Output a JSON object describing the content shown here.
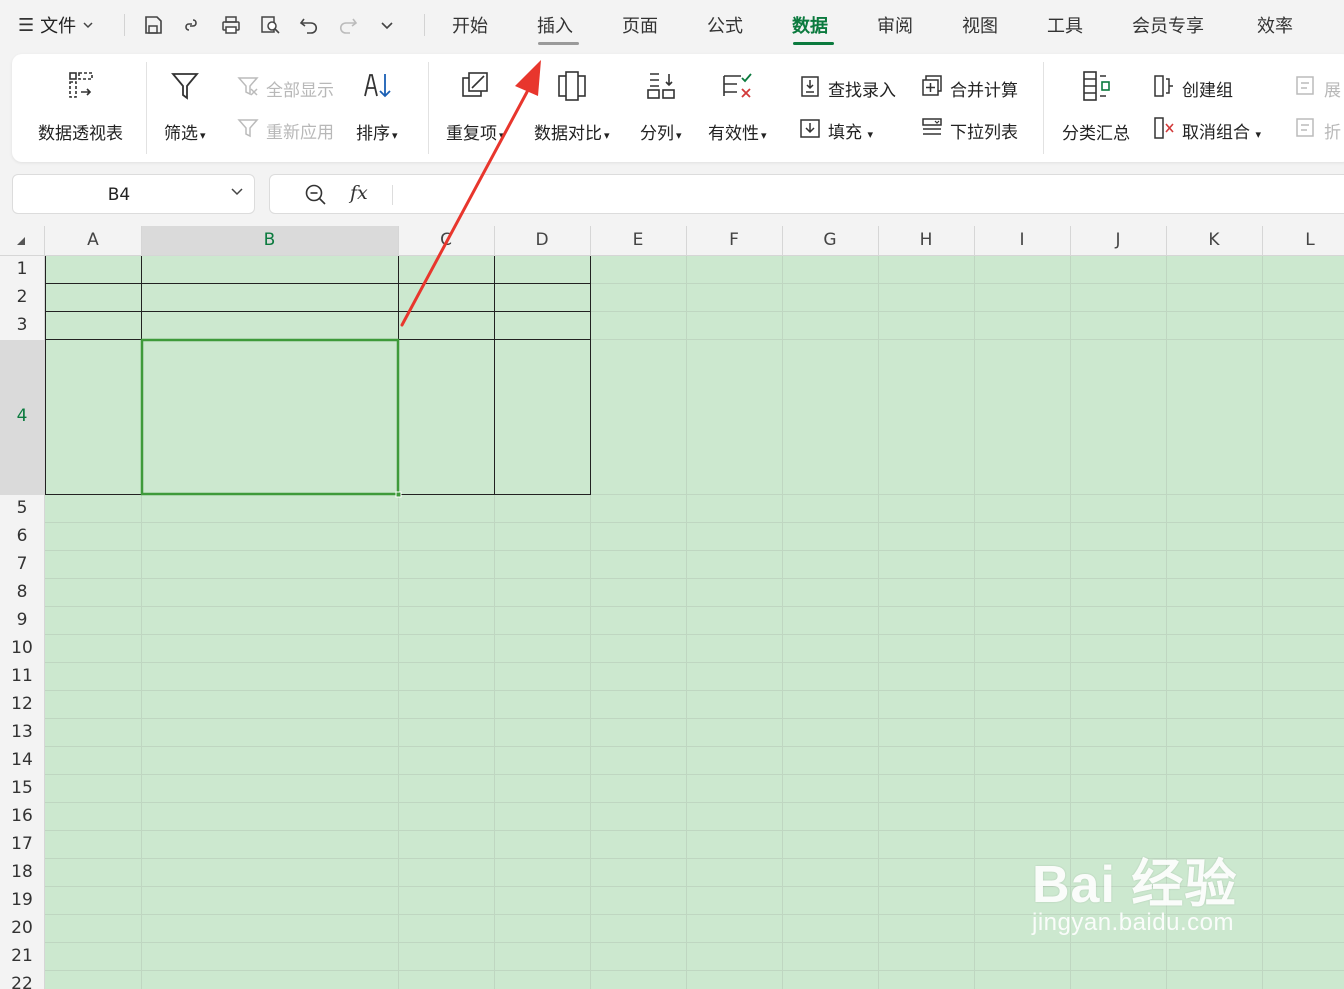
{
  "menubar": {
    "file_label": "文件",
    "tabs": [
      {
        "label": "开始"
      },
      {
        "label": "插入"
      },
      {
        "label": "页面"
      },
      {
        "label": "公式"
      },
      {
        "label": "数据"
      },
      {
        "label": "审阅"
      },
      {
        "label": "视图"
      },
      {
        "label": "工具"
      },
      {
        "label": "会员专享"
      },
      {
        "label": "效率"
      }
    ],
    "active_tab": "数据",
    "hover_tab": "插入",
    "accent_color": "#0b7a3e"
  },
  "ribbon": {
    "pivot": "数据透视表",
    "filter": "筛选",
    "show_all": "全部显示",
    "reapply": "重新应用",
    "sort": "排序",
    "duplicates": "重复项",
    "compare": "数据对比",
    "split": "分列",
    "validation": "有效性",
    "find_entry": "查找录入",
    "fill": "填充",
    "consolidate": "合并计算",
    "dropdown_list": "下拉列表",
    "subtotal": "分类汇总",
    "create_group": "创建组",
    "ungroup": "取消组合",
    "expand": "展",
    "collapse": "折"
  },
  "formula": {
    "cell_ref": "B4",
    "fx_label": "fx",
    "value": ""
  },
  "sheet": {
    "columns": [
      "A",
      "B",
      "C",
      "D",
      "E",
      "F",
      "G",
      "H",
      "I",
      "J",
      "K",
      "L"
    ],
    "rows": [
      "1",
      "2",
      "3",
      "4",
      "5",
      "6",
      "7",
      "8",
      "9",
      "10",
      "11",
      "12",
      "13",
      "14",
      "15",
      "16",
      "17",
      "18",
      "19",
      "20",
      "21",
      "22"
    ],
    "selected_cell": "B4",
    "background_color": "#cce8cf"
  },
  "watermark": {
    "main": "Bai 经验",
    "sub": "jingyan.baidu.com"
  }
}
